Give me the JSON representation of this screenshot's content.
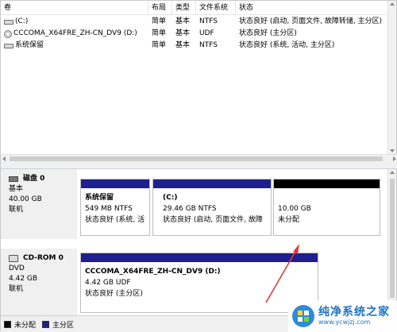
{
  "columns": [
    "卷",
    "布局",
    "类型",
    "文件系统",
    "状态"
  ],
  "volumes": [
    {
      "icon": "drive-icon",
      "name": "(C:)",
      "layout": "简单",
      "type": "基本",
      "fs": "NTFS",
      "status": "状态良好 (启动, 页面文件, 故障转储, 主分区)"
    },
    {
      "icon": "disc-icon",
      "name": "CCCOMA_X64FRE_ZH-CN_DV9 (D:)",
      "layout": "简单",
      "type": "基本",
      "fs": "UDF",
      "status": "状态良好 (主分区)"
    },
    {
      "icon": "drive-icon",
      "name": "系统保留",
      "layout": "简单",
      "type": "基本",
      "fs": "NTFS",
      "status": "状态良好 (系统, 活动, 主分区)"
    }
  ],
  "disks": [
    {
      "title": "磁盘 0",
      "type": "基本",
      "size": "40.00 GB",
      "state": "联机",
      "partitions": [
        {
          "name": "系统保留",
          "size": "549 MB NTFS",
          "status": "状态良好 (系统, 活",
          "bar": "#1f1f8f"
        },
        {
          "name": "(C:)",
          "size": "29.46 GB NTFS",
          "status": "状态良好 (启动, 页面文件, 故障",
          "bar": "#1f1f8f"
        },
        {
          "name": "",
          "size": "10.00 GB",
          "status": "未分配",
          "bar": "#000000"
        }
      ]
    },
    {
      "title": "CD-ROM 0",
      "type": "DVD",
      "size": "4.42 GB",
      "state": "联机",
      "partitions": [
        {
          "name": "CCCOMA_X64FRE_ZH-CN_DV9  (D:)",
          "size": "4.42 GB UDF",
          "status": "状态良好 (主分区)",
          "bar": "#1f1f8f"
        }
      ]
    }
  ],
  "legend": [
    {
      "label": "未分配",
      "color": "#000000"
    },
    {
      "label": "主分区",
      "color": "#1f1f8f"
    }
  ],
  "watermark": {
    "title": "纯净系统之家",
    "url": "www.ycwjzj.com"
  },
  "annotation_color": "#e03a3a"
}
